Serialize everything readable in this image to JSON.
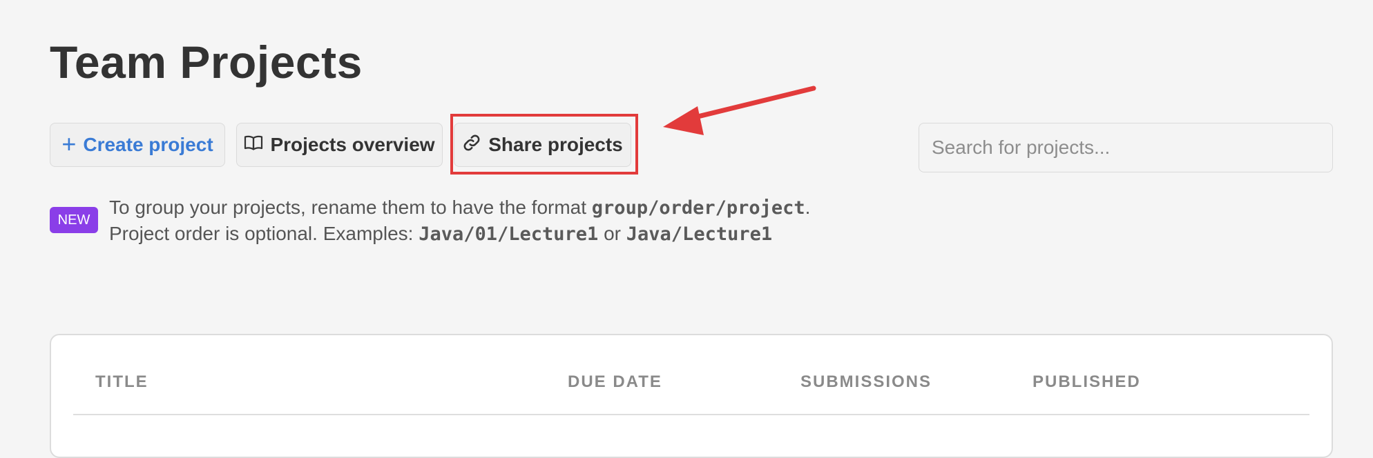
{
  "page": {
    "title": "Team Projects"
  },
  "toolbar": {
    "create_label": "Create project",
    "create_icon": "plus-icon",
    "overview_label": "Projects overview",
    "overview_icon": "book-open-icon",
    "share_label": "Share projects",
    "share_icon": "link-icon"
  },
  "search": {
    "placeholder": "Search for projects...",
    "value": ""
  },
  "notice": {
    "badge": "NEW",
    "line1_text": "To group your projects, rename them to have the format ",
    "line1_code": "group/order/project",
    "line1_end": ".",
    "line2_text": "Project order is optional. Examples: ",
    "example1": "Java/01/Lecture1",
    "or": " or ",
    "example2": "Java/Lecture1"
  },
  "table": {
    "columns": [
      "TITLE",
      "DUE DATE",
      "SUBMISSIONS",
      "PUBLISHED"
    ]
  },
  "colors": {
    "accent_blue": "#3a7bd5",
    "annotation_red": "#e23b3b",
    "badge_purple": "#8a3ee8",
    "background": "#f5f5f5"
  }
}
